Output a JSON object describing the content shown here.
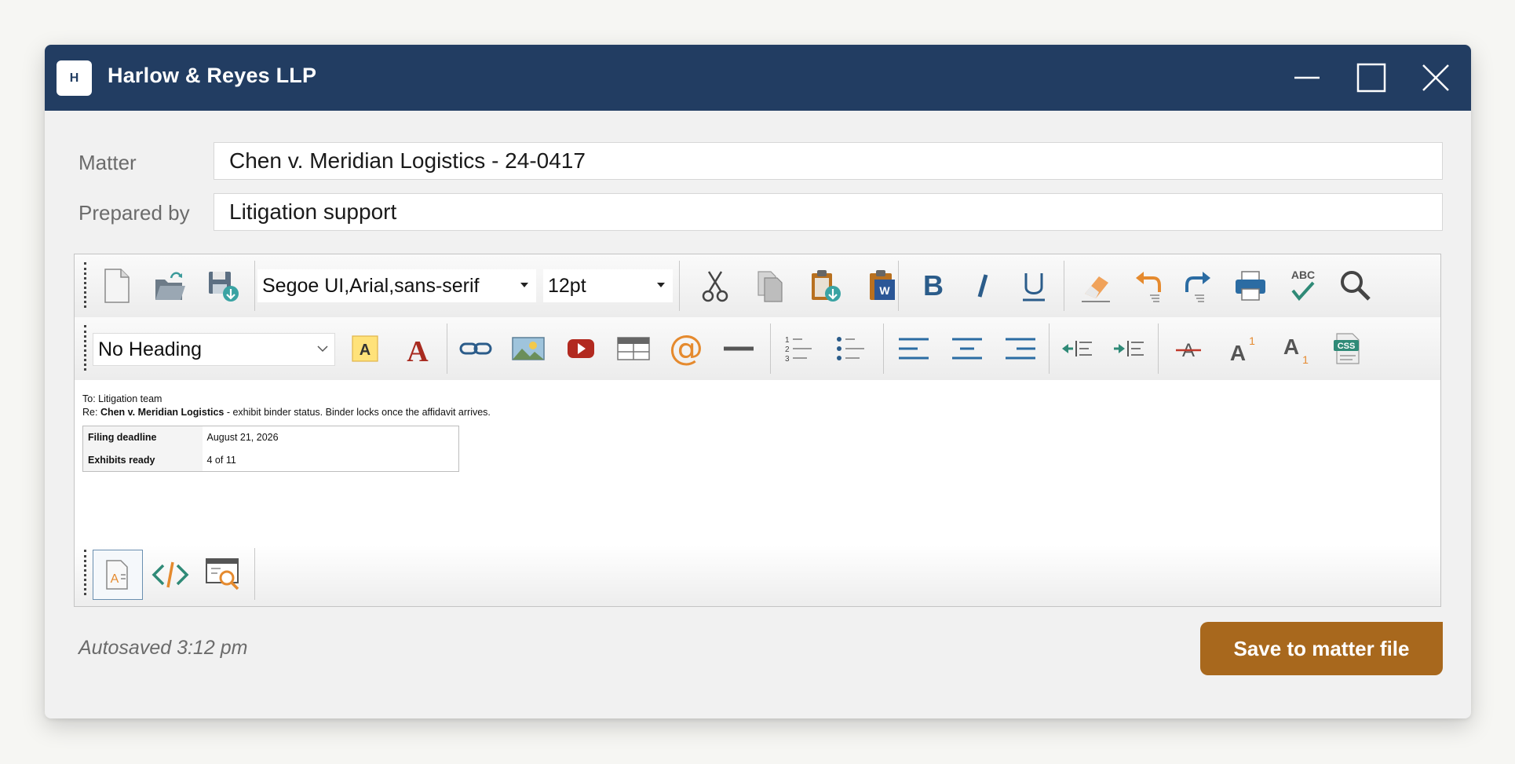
{
  "window": {
    "logo_letter": "H",
    "title": "Harlow & Reyes LLP"
  },
  "form": {
    "matter_label": "Matter",
    "matter_value": "Chen v. Meridian Logistics - 24-0417",
    "prepared_label": "Prepared by",
    "prepared_value": "Litigation support"
  },
  "toolbar": {
    "font_family": "Segoe UI,Arial,sans-serif",
    "font_size": "12pt",
    "heading": "No Heading",
    "spellcheck_label": "ABC",
    "css_label": "CSS",
    "superscript_label": "A",
    "superscript_digit": "1",
    "subscript_label": "A",
    "subscript_digit": "1"
  },
  "document": {
    "to_line": "To: Litigation team",
    "re_prefix": "Re: ",
    "re_case": "Chen v. Meridian Logistics",
    "re_rest": " - exhibit binder status. Binder locks once the affidavit arrives.",
    "table": [
      {
        "key": "Filing deadline",
        "value": "August 21, 2026"
      },
      {
        "key": "Exhibits ready",
        "value": "4 of 11"
      }
    ]
  },
  "footer": {
    "autosave": "Autosaved 3:12 pm",
    "save_button": "Save to matter file"
  },
  "colors": {
    "titlebar": "#223d62",
    "accent": "#a8681d"
  }
}
